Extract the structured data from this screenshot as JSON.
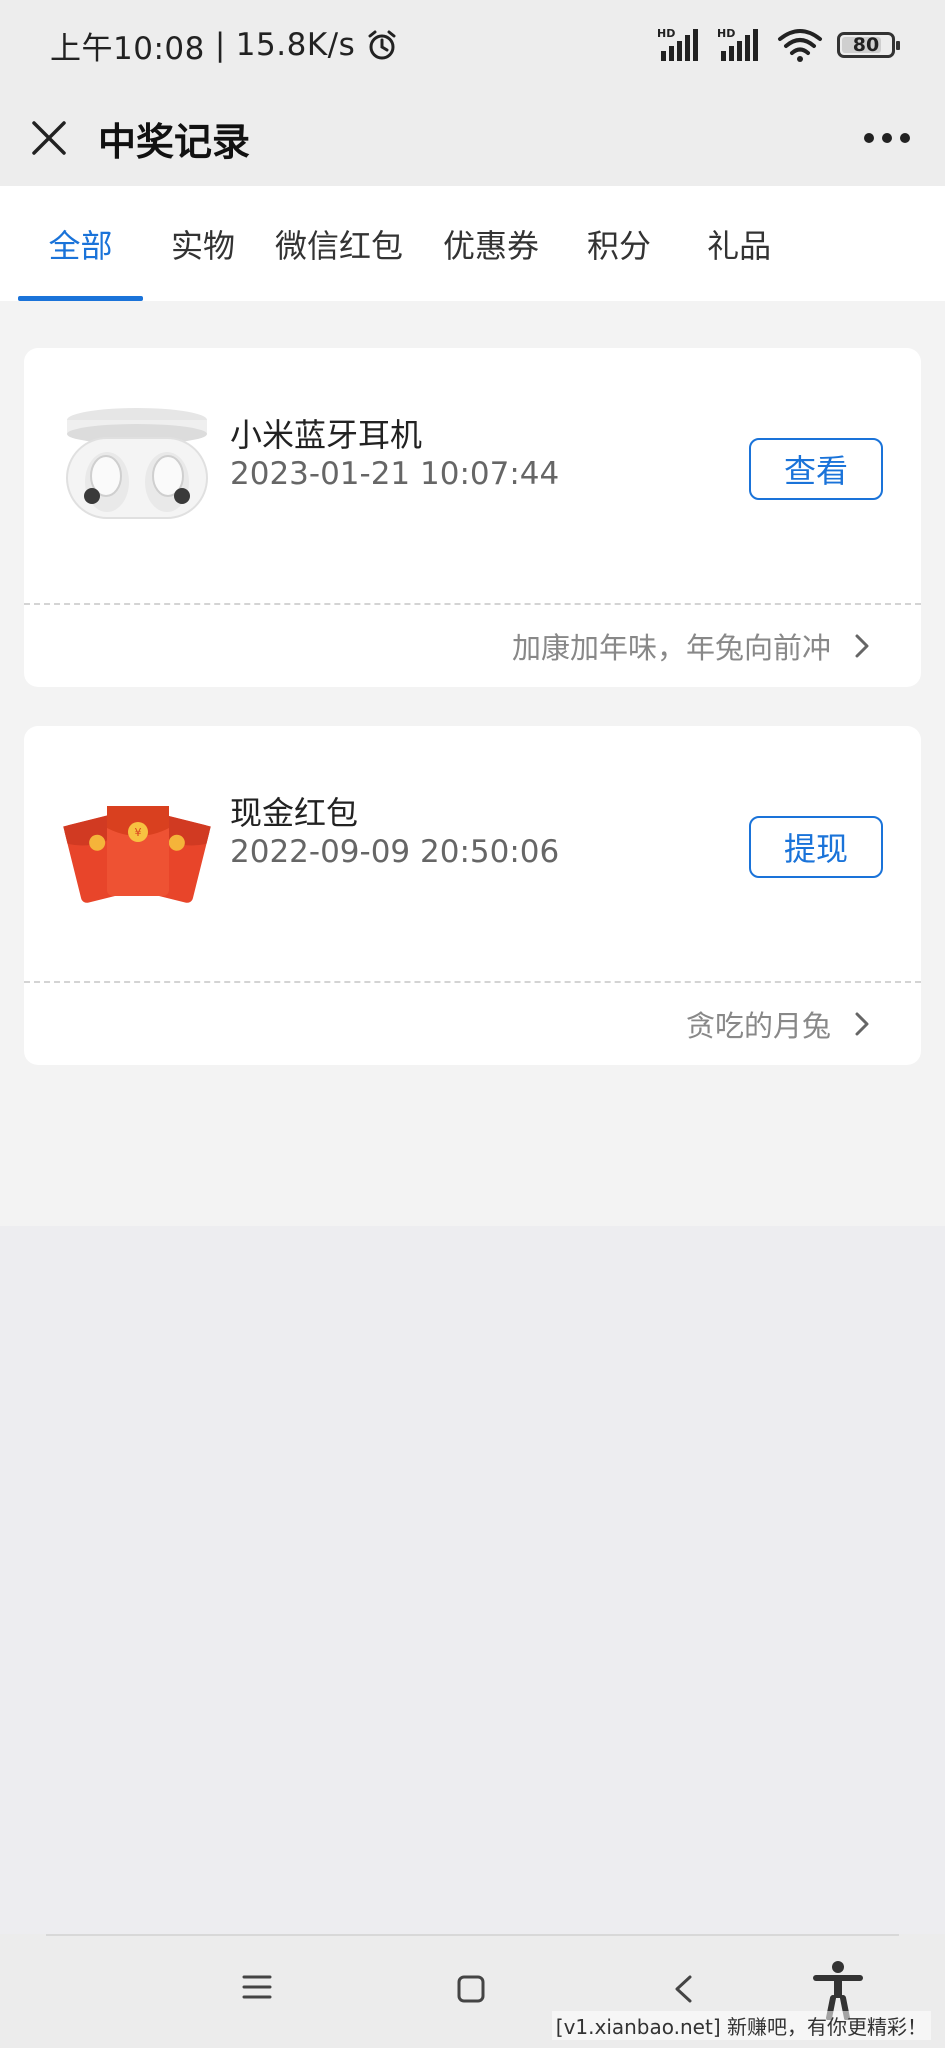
{
  "status_bar": {
    "time": "上午10:08",
    "separator": "|",
    "net_speed": "15.8K/s",
    "hd_label_1": "HD",
    "hd_label_2": "HD",
    "battery": "80"
  },
  "header": {
    "title": "中奖记录"
  },
  "tabs": [
    {
      "label": "全部",
      "active": true
    },
    {
      "label": "实物"
    },
    {
      "label": "微信红包"
    },
    {
      "label": "优惠券"
    },
    {
      "label": "积分"
    },
    {
      "label": "礼品"
    }
  ],
  "records": [
    {
      "name": "小米蓝牙耳机",
      "time": "2023-01-21 10:07:44",
      "action": "查看",
      "activity": "加康加年味，年兔向前冲",
      "icon": "earbuds-image"
    },
    {
      "name": "现金红包",
      "time": "2022-09-09 20:50:06",
      "action": "提现",
      "activity": "贪吃的月兔",
      "icon": "red-envelope-image"
    }
  ],
  "watermark": "[v1.xianbao.net] 新赚吧，有你更精彩！",
  "colors": {
    "accent": "#1a73d9",
    "page_bg": "#ededf0",
    "red_envelope": "#e8452a"
  }
}
